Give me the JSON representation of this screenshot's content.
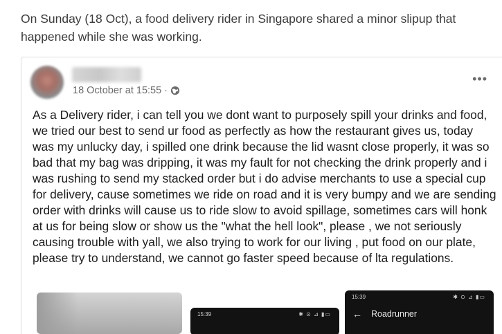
{
  "article": {
    "intro": "On Sunday (18 Oct), a food delivery rider in Singapore shared a minor slipup that happened while she was working."
  },
  "post": {
    "timestamp": "18 October at 15:55",
    "separator": "·",
    "privacy_icon": "globe-icon",
    "more_label": "•••",
    "body": "As a Delivery rider, i can tell you we dont want to purposely spill your drinks and food,  we tried our best to send ur food as perfectly as how the restaurant gives us, today was my unlucky day,  i spilled one drink because the lid wasnt close properly, it was so bad that my bag was dripping, it was my fault for not checking the drink properly and i was rushing to send my stacked order but i do advise merchants to use a special cup for delivery,  cause sometimes we ride on road and it is very bumpy and we are sending order with drinks will cause us to ride slow to avoid spillage, sometimes cars will honk at us for being slow or show us the \"what the hell look\", please , we not seriously causing trouble with yall,  we also trying to work for our living , put food on our plate, please try to understand, we cannot go faster speed because of lta regulations."
  },
  "screenshots": {
    "second": {
      "status_time": "15:39",
      "status_icons": "✱ ⊙ ⊿ ▮▭"
    },
    "third": {
      "status_time": "15:39",
      "status_icons": "✱ ⊙ ⊿ ▮▭",
      "back_icon": "←",
      "title": "Roadrunner"
    }
  },
  "colors": {
    "text": "#3a3a3a",
    "post_text": "#1c1c1c",
    "meta": "#6b6b6b",
    "border": "#dcdcdc",
    "phone_bg": "#121212"
  }
}
